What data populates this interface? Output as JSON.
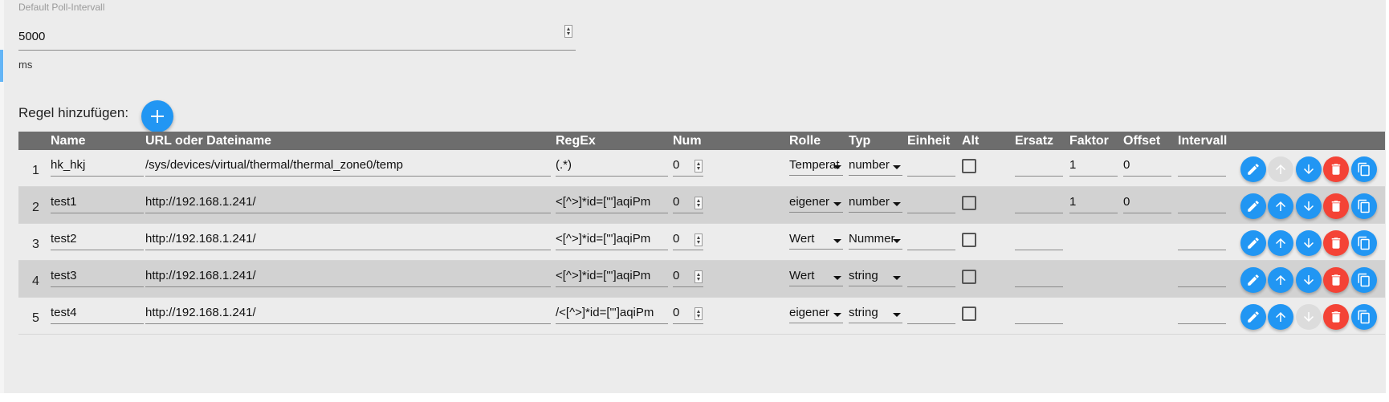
{
  "poll": {
    "label": "Default Poll-Intervall",
    "value": "5000",
    "unit": "ms"
  },
  "add_rule": {
    "label": "Regel hinzufügen:",
    "icon": "plus-icon"
  },
  "table": {
    "headers": [
      "Name",
      "URL oder Dateiname",
      "RegEx",
      "Num",
      "Rolle",
      "Typ",
      "Einheit",
      "Alt",
      "Ersatz",
      "Faktor",
      "Offset",
      "Intervall"
    ],
    "rows": [
      {
        "num": "1",
        "name": "hk_hkj",
        "url": "/sys/devices/virtual/thermal/thermal_zone0/temp",
        "regex": "(.*)",
        "numval": "0",
        "rolle": "Temperat",
        "typ": "number",
        "einheit": "",
        "alt": false,
        "ersatz": "",
        "faktor": "1",
        "offset": "0",
        "intervall": "",
        "up_enabled": false,
        "down_enabled": true
      },
      {
        "num": "2",
        "name": "test1",
        "url": "http://192.168.1.241/",
        "regex": "<[^>]*id=[\"']aqiPm",
        "numval": "0",
        "rolle": "eigener",
        "typ": "number",
        "einheit": "",
        "alt": false,
        "ersatz": "",
        "faktor": "1",
        "offset": "0",
        "intervall": "",
        "up_enabled": true,
        "down_enabled": true
      },
      {
        "num": "3",
        "name": "test2",
        "url": "http://192.168.1.241/",
        "regex": "<[^>]*id=[\"']aqiPm",
        "numval": "0",
        "rolle": "Wert",
        "typ": "Nummer",
        "einheit": "",
        "alt": false,
        "ersatz": "",
        "faktor": "",
        "offset": "",
        "intervall": "",
        "up_enabled": true,
        "down_enabled": true
      },
      {
        "num": "4",
        "name": "test3",
        "url": "http://192.168.1.241/",
        "regex": "<[^>]*id=[\"']aqiPm",
        "numval": "0",
        "rolle": "Wert",
        "typ": "string",
        "einheit": "",
        "alt": false,
        "ersatz": "",
        "faktor": "",
        "offset": "",
        "intervall": "",
        "up_enabled": true,
        "down_enabled": true
      },
      {
        "num": "5",
        "name": "test4",
        "url": "http://192.168.1.241/",
        "regex": "/<[^>]*id=[\"']aqiPm",
        "numval": "0",
        "rolle": "eigener",
        "typ": "string",
        "einheit": "",
        "alt": false,
        "ersatz": "",
        "faktor": "",
        "offset": "",
        "intervall": "",
        "up_enabled": true,
        "down_enabled": false
      }
    ],
    "actions": {
      "edit_icon": "pencil-icon",
      "up_icon": "arrow-up-icon",
      "down_icon": "arrow-down-icon",
      "delete_icon": "trash-icon",
      "copy_icon": "copy-icon"
    }
  },
  "colors": {
    "accent": "#2196f3",
    "danger": "#f44336",
    "header_bg": "#6d6d6d",
    "row_alt_bg": "#d2d2d2",
    "page_bg": "#ececec",
    "disabled": "#dcdcdc"
  }
}
